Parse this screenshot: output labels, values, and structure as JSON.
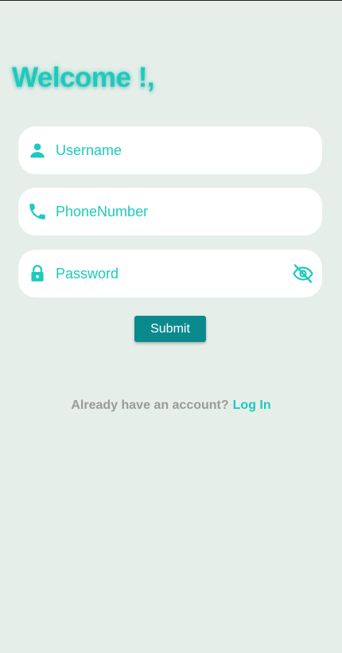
{
  "header": {
    "title": "Welcome !,"
  },
  "form": {
    "username": {
      "placeholder": "Username",
      "value": "",
      "icon": "person-icon"
    },
    "phone": {
      "placeholder": "PhoneNumber",
      "value": "",
      "icon": "phone-icon"
    },
    "password": {
      "placeholder": "Password",
      "value": "",
      "icon": "lock-icon",
      "toggle_icon": "eye-off-icon"
    },
    "submit_label": "Submit"
  },
  "footer": {
    "prompt": "Already have an account?",
    "link": "Log In"
  },
  "colors": {
    "background": "#e6eeea",
    "accent": "#1ec9bd",
    "button": "#0b8a8d",
    "muted_text": "#9a9a9a"
  }
}
